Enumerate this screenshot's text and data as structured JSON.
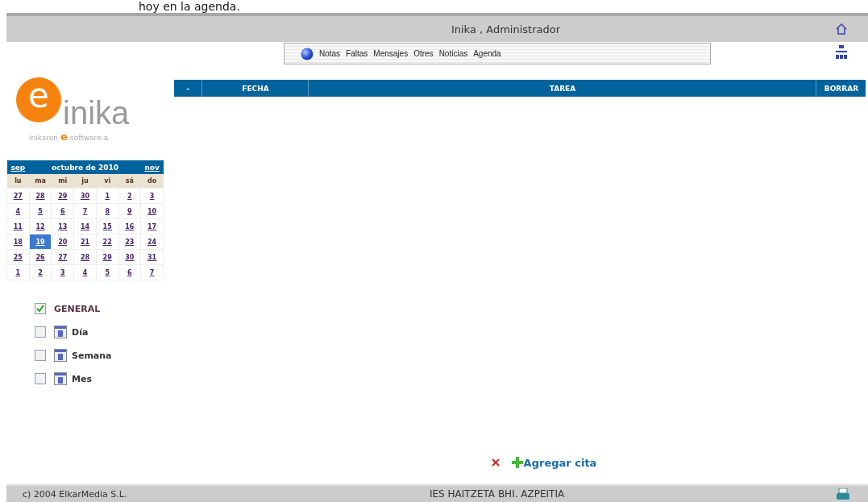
{
  "caption": "hoy en la agenda.",
  "header": {
    "title": "Inika , Administrador"
  },
  "menu": [
    "Notas",
    "Faltas",
    "Mensajes",
    "Otres",
    "Noticias",
    "Agenda"
  ],
  "logo": {
    "letter": "e",
    "name": "inika",
    "tagline_before": "inikaren ",
    "tagline_mark": "e",
    "tagline_after": "-software-a"
  },
  "calendar": {
    "prev": "sep",
    "title": "octubre de 2010",
    "next": "nov",
    "weekdays": [
      "lu",
      "ma",
      "mi",
      "ju",
      "vi",
      "sá",
      "do"
    ],
    "weeks": [
      [
        {
          "day": "27",
          "selected": false
        },
        {
          "day": "28",
          "selected": false
        },
        {
          "day": "29",
          "selected": false
        },
        {
          "day": "30",
          "selected": false
        },
        {
          "day": "1",
          "selected": false
        },
        {
          "day": "2",
          "selected": false
        },
        {
          "day": "3",
          "selected": false
        }
      ],
      [
        {
          "day": "4",
          "selected": false
        },
        {
          "day": "5",
          "selected": false
        },
        {
          "day": "6",
          "selected": false
        },
        {
          "day": "7",
          "selected": false
        },
        {
          "day": "8",
          "selected": false
        },
        {
          "day": "9",
          "selected": false
        },
        {
          "day": "10",
          "selected": false
        }
      ],
      [
        {
          "day": "11",
          "selected": false
        },
        {
          "day": "12",
          "selected": false
        },
        {
          "day": "13",
          "selected": false
        },
        {
          "day": "14",
          "selected": false
        },
        {
          "day": "15",
          "selected": false
        },
        {
          "day": "16",
          "selected": false
        },
        {
          "day": "17",
          "selected": false
        }
      ],
      [
        {
          "day": "18",
          "selected": false
        },
        {
          "day": "19",
          "selected": true
        },
        {
          "day": "20",
          "selected": false
        },
        {
          "day": "21",
          "selected": false
        },
        {
          "day": "22",
          "selected": false
        },
        {
          "day": "23",
          "selected": false
        },
        {
          "day": "24",
          "selected": false
        }
      ],
      [
        {
          "day": "25",
          "selected": false
        },
        {
          "day": "26",
          "selected": false
        },
        {
          "day": "27",
          "selected": false
        },
        {
          "day": "28",
          "selected": false
        },
        {
          "day": "29",
          "selected": false
        },
        {
          "day": "30",
          "selected": false
        },
        {
          "day": "31",
          "selected": false
        }
      ],
      [
        {
          "day": "1",
          "selected": false
        },
        {
          "day": "2",
          "selected": false
        },
        {
          "day": "3",
          "selected": false
        },
        {
          "day": "4",
          "selected": false
        },
        {
          "day": "5",
          "selected": false
        },
        {
          "day": "6",
          "selected": false
        },
        {
          "day": "7",
          "selected": false
        }
      ]
    ]
  },
  "filters": [
    {
      "label": "GENERAL",
      "checked": true,
      "kind": "plain"
    },
    {
      "label": "Día",
      "checked": false,
      "kind": "day"
    },
    {
      "label": "Semana",
      "checked": false,
      "kind": "week"
    },
    {
      "label": "Mes",
      "checked": false,
      "kind": "month"
    }
  ],
  "table": {
    "columns": [
      "-",
      "FECHA",
      "TAREA",
      "BORRAR"
    ]
  },
  "add_link": "Agregar cita",
  "footer": {
    "copyright": "c) 2004 ElkarMedia S.L.",
    "school": "IES HAITZETA BHI. AZPEITIA"
  }
}
